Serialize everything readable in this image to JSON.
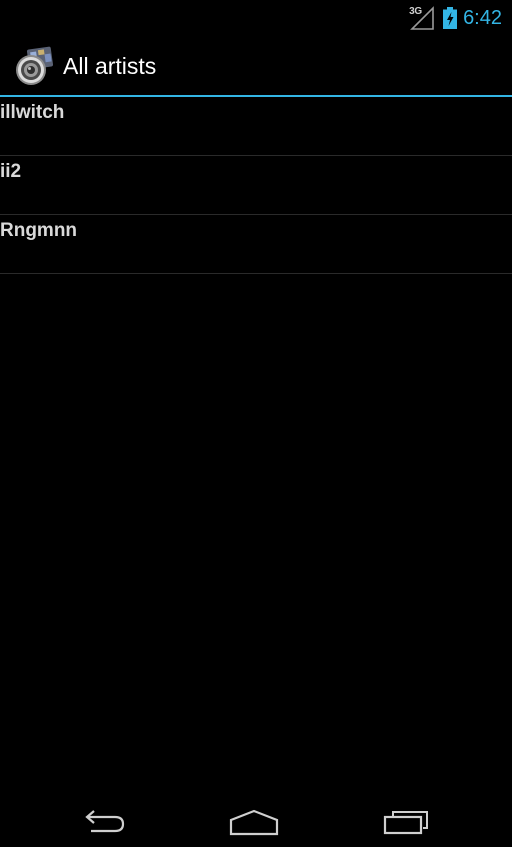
{
  "status_bar": {
    "network_type": "3G",
    "time": "6:42",
    "icons": [
      "signal-icon",
      "battery-charging-icon"
    ]
  },
  "action_bar": {
    "title": "All artists",
    "app_icon": "speaker-app-icon"
  },
  "artists": [
    {
      "name": "illwitch"
    },
    {
      "name": "ii2"
    },
    {
      "name": "Rngmnn"
    }
  ],
  "nav_bar": {
    "icons": [
      "back-icon",
      "home-icon",
      "recent-apps-icon"
    ]
  },
  "colors": {
    "accent": "#33b5e5",
    "background": "#000000",
    "list_text": "#d9d9d9",
    "divider": "#2a2a2a"
  }
}
